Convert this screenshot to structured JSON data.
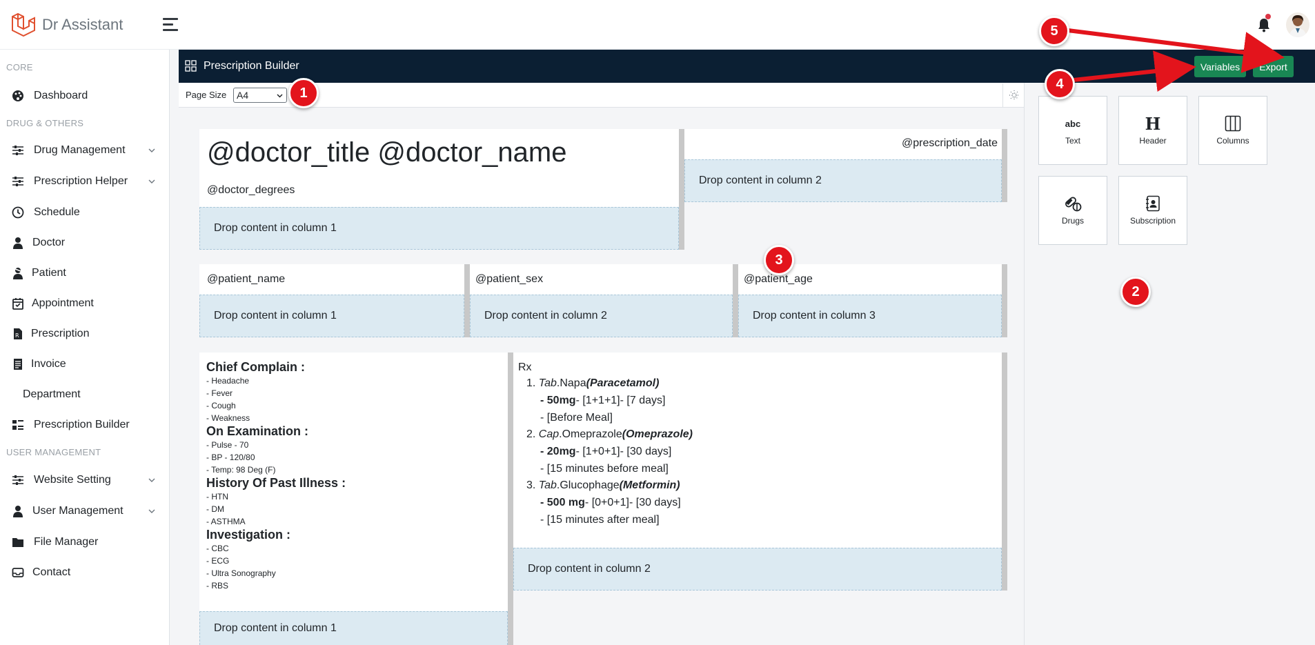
{
  "app": {
    "brand": "Dr Assistant"
  },
  "sidebar": {
    "headings": [
      "CORE",
      "DRUG & OTHERS",
      "USER MANAGEMENT"
    ],
    "items": [
      {
        "label": "Dashboard",
        "icon": "palette-icon"
      },
      {
        "label": "Drug Management",
        "icon": "sliders-icon",
        "expandable": true
      },
      {
        "label": "Prescription Helper",
        "icon": "sliders-icon",
        "expandable": true
      },
      {
        "label": "Schedule",
        "icon": "clock-icon"
      },
      {
        "label": "Doctor",
        "icon": "user-doctor-icon"
      },
      {
        "label": "Patient",
        "icon": "user-injured-icon"
      },
      {
        "label": "Appointment",
        "icon": "calendar-check-icon"
      },
      {
        "label": "Prescription",
        "icon": "file-prescription-icon"
      },
      {
        "label": "Invoice",
        "icon": "invoice-icon"
      },
      {
        "label": "Department",
        "icon": ""
      },
      {
        "label": "Prescription Builder",
        "icon": "builder-icon"
      },
      {
        "label": "Website Setting",
        "icon": "sliders-icon",
        "expandable": true
      },
      {
        "label": "User Management",
        "icon": "user-icon",
        "expandable": true
      },
      {
        "label": "File Manager",
        "icon": "folder-icon"
      },
      {
        "label": "Contact",
        "icon": "inbox-icon"
      }
    ]
  },
  "builder": {
    "title": "Prescription Builder",
    "variables_label": "Variables",
    "export_label": "Export",
    "page_size_label": "Page Size",
    "page_size_value": "A4"
  },
  "components": [
    {
      "label": "Text",
      "icon": "abc"
    },
    {
      "label": "Header",
      "icon": "H"
    },
    {
      "label": "Columns",
      "icon": "columns-icon"
    },
    {
      "label": "Drugs",
      "icon": "pills-icon"
    },
    {
      "label": "Subscription",
      "icon": "contact-book-icon"
    }
  ],
  "canvas": {
    "row1": {
      "doctor_title": "@doctor_title @doctor_name",
      "doctor_degrees": "@doctor_degrees",
      "prescription_date": "@prescription_date",
      "drop1": "Drop content in column 1",
      "drop2": "Drop content in column 2"
    },
    "row2": {
      "patient_name": "@patient_name",
      "patient_sex": "@patient_sex",
      "patient_age": "@patient_age",
      "drop1": "Drop content in column 1",
      "drop2": "Drop content in column 2",
      "drop3": "Drop content in column 3"
    },
    "row3": {
      "sections": [
        {
          "title": "Chief Complain :",
          "items": [
            "- Headache",
            "- Fever",
            "- Cough",
            "- Weakness"
          ]
        },
        {
          "title": "On Examination :",
          "items": [
            "- Pulse - 70",
            "- BP - 120/80",
            "- Temp: 98 Deg (F)"
          ]
        },
        {
          "title": "History Of Past Illness :",
          "items": [
            "- HTN",
            "- DM",
            "- ASTHMA"
          ]
        },
        {
          "title": "Investigation :",
          "items": [
            "- CBC",
            "- ECG",
            "- Ultra Sonography",
            "- RBS"
          ]
        }
      ],
      "rx_label": "Rx",
      "drugs": [
        {
          "num": "1.",
          "form": "Tab",
          "name": ".Napa",
          "generic": "(Paracetamol)",
          "dose": "- 50mg",
          "schedule": "- [1+1+1]- [7 days]",
          "note": "- [Before Meal]"
        },
        {
          "num": "2.",
          "form": "Cap",
          "name": ".Omeprazole",
          "generic": "(Omeprazole)",
          "dose": "- 20mg",
          "schedule": "- [1+0+1]- [30 days]",
          "note": "- [15 minutes before meal]"
        },
        {
          "num": "3.",
          "form": "Tab",
          "name": ".Glucophage",
          "generic": "(Metformin)",
          "dose": "- 500 mg",
          "schedule": "- [0+0+1]- [30 days]",
          "note": "- [15 minutes after meal]"
        }
      ],
      "drop1": "Drop content in column 1",
      "drop2": "Drop content in column 2"
    }
  },
  "callouts": [
    "1",
    "2",
    "3",
    "4",
    "5"
  ],
  "colors": {
    "accent": "#198754",
    "header_bg": "#0b1f33",
    "drop_bg": "#dceaf2",
    "callout": "#e3141c"
  }
}
